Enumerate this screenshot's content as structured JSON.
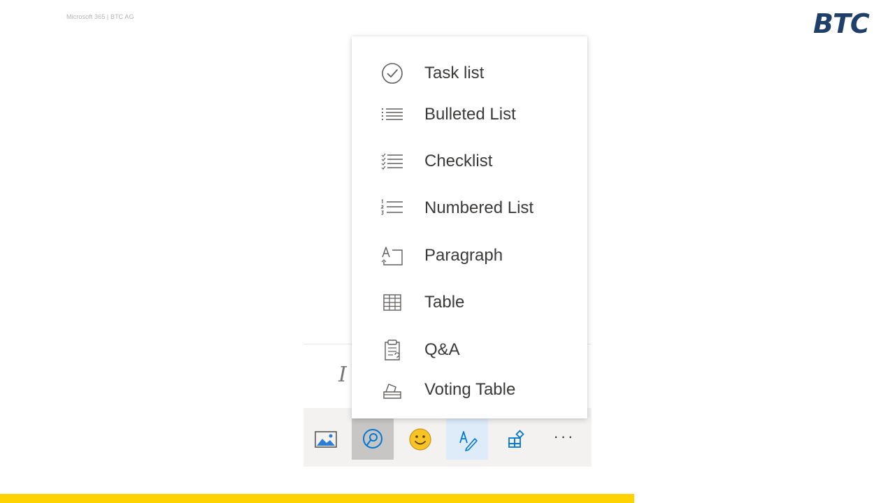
{
  "header": {
    "text": "Microsoft 365 | BTC AG",
    "logo": "BTC"
  },
  "colors": {
    "logo": "#1f3f6b",
    "accent_bar": "#ffd200",
    "icon_blue": "#0078d4",
    "menu_text": "#3b3a39"
  },
  "editor": {
    "format_glyph": "I"
  },
  "menu": {
    "items": [
      {
        "label": "Task list",
        "icon": "check-circle-icon"
      },
      {
        "label": "Bulleted List",
        "icon": "bulleted-list-icon"
      },
      {
        "label": "Checklist",
        "icon": "checklist-icon"
      },
      {
        "label": "Numbered List",
        "icon": "numbered-list-icon"
      },
      {
        "label": "Paragraph",
        "icon": "paragraph-icon"
      },
      {
        "label": "Table",
        "icon": "table-icon"
      },
      {
        "label": "Q&A",
        "icon": "clipboard-qa-icon"
      },
      {
        "label": "Voting Table",
        "icon": "ballot-box-icon"
      }
    ]
  },
  "toolbar": {
    "buttons": [
      {
        "icon": "image-icon"
      },
      {
        "icon": "loop-component-icon",
        "state": "pressed"
      },
      {
        "icon": "emoji-icon"
      },
      {
        "icon": "format-text-icon",
        "state": "active"
      },
      {
        "icon": "apps-icon"
      },
      {
        "icon": "more-icon",
        "label": "···"
      }
    ]
  }
}
